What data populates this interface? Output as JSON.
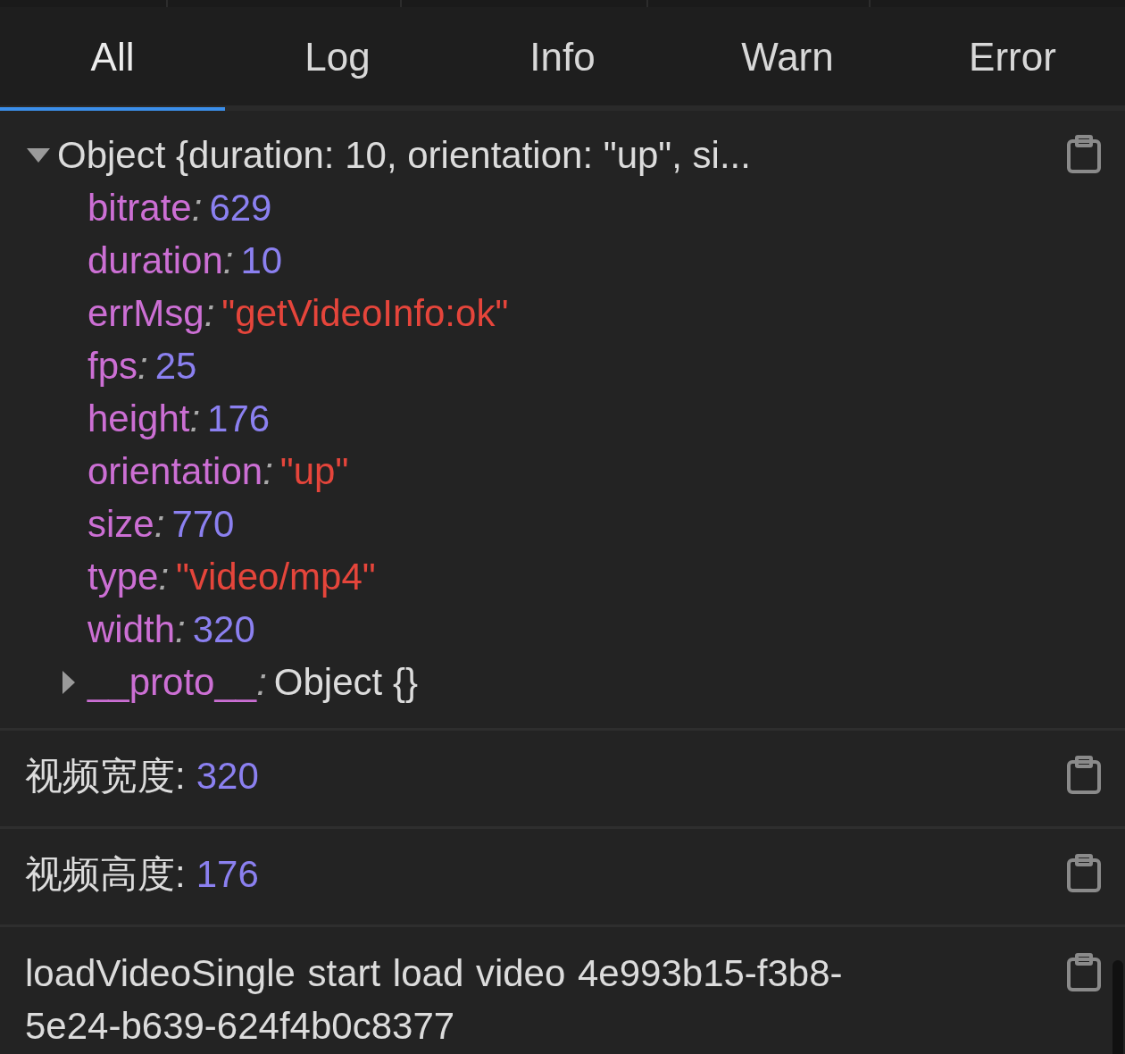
{
  "tabs": [
    {
      "label": "All",
      "selected": true
    },
    {
      "label": "Log",
      "selected": false
    },
    {
      "label": "Info",
      "selected": false
    },
    {
      "label": "Warn",
      "selected": false
    },
    {
      "label": "Error",
      "selected": false
    }
  ],
  "entries": [
    {
      "kind": "object",
      "summary": "Object {duration: 10, orientation: \"up\", si...",
      "expanded": true,
      "separator": ":",
      "properties": [
        {
          "name": "bitrate",
          "kind": "number",
          "value": "629"
        },
        {
          "name": "duration",
          "kind": "number",
          "value": "10"
        },
        {
          "name": "errMsg",
          "kind": "string",
          "value": "\"getVideoInfo:ok\""
        },
        {
          "name": "fps",
          "kind": "number",
          "value": "25"
        },
        {
          "name": "height",
          "kind": "number",
          "value": "176"
        },
        {
          "name": "orientation",
          "kind": "string",
          "value": "\"up\""
        },
        {
          "name": "size",
          "kind": "number",
          "value": "770"
        },
        {
          "name": "type",
          "kind": "string",
          "value": "\"video/mp4\""
        },
        {
          "name": "width",
          "kind": "number",
          "value": "320"
        },
        {
          "name": "__proto__",
          "kind": "object",
          "value": "Object {}",
          "expanded": false
        }
      ]
    },
    {
      "kind": "labeled",
      "label": "视频宽度:",
      "value": "320"
    },
    {
      "kind": "labeled",
      "label": "视频高度:",
      "value": "176"
    },
    {
      "kind": "text",
      "text": "loadVideoSingle start load video  4e993b15-f3b8-5e24-b639-624f4b0c8377"
    }
  ]
}
